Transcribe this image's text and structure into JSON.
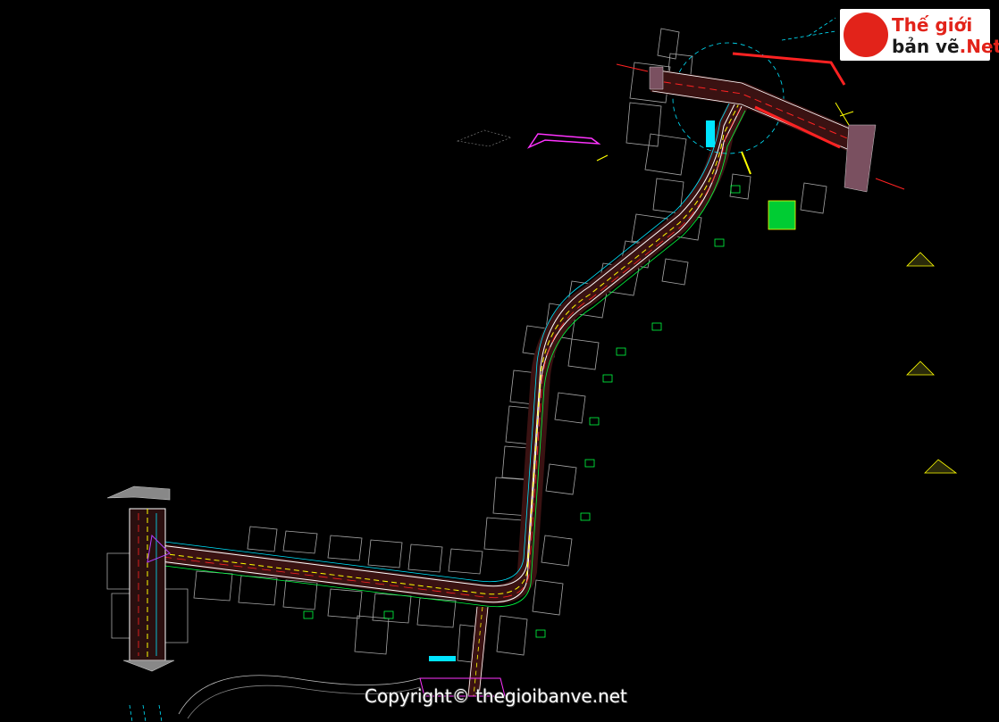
{
  "watermark": {
    "brand_line1": "Thế giới",
    "brand_line2": "bản vẽ",
    "brand_suffix": ".Net",
    "copyright": "Copyright© thegioibanve.net"
  },
  "colors": {
    "background": "#000000",
    "road_edge": "#ffffff",
    "road_fill": "#5a1f1f",
    "centerline": "#ffff00",
    "offset_cyan": "#00e5ff",
    "offset_green": "#00ff40",
    "accent_magenta": "#ff33ff",
    "buildings": "#b0b0b0",
    "brand_red": "#e2231a"
  }
}
